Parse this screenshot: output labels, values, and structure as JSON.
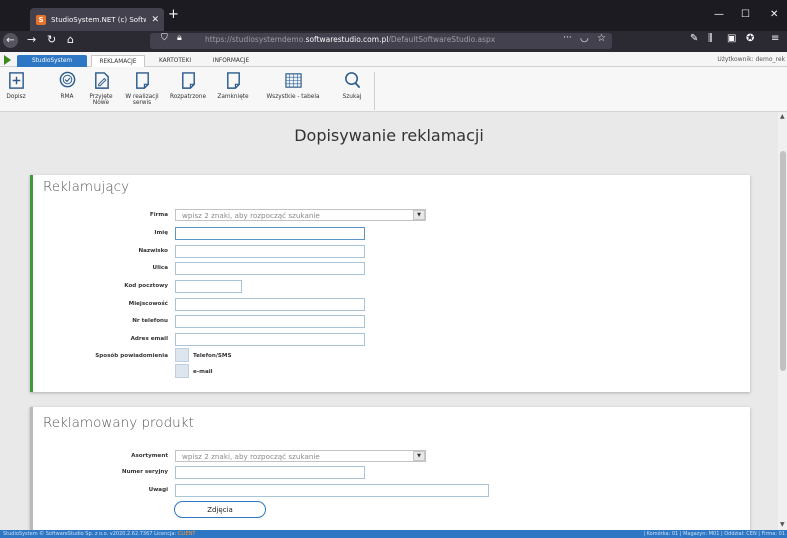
{
  "browser": {
    "tab_title": "StudioSystem.NET (c) Software",
    "tab_favicon": "S",
    "new_tab": "+",
    "url_prefix": "https://studiosystemdemo.",
    "url_domain": "softwarestudio.com.pl",
    "url_path": "/DefaultSoftwareStudio.aspx",
    "url_more": "···"
  },
  "menu": {
    "brand": "StudioSystem",
    "tabs": [
      "REKLAMACJE",
      "KARTOTEKI",
      "INFORMACJE"
    ],
    "user": "Użytkownik: demo_rek"
  },
  "ribbon": [
    {
      "label": "Dopisz",
      "label2": "",
      "icon": "add-document-icon"
    },
    {
      "label": "RMA",
      "label2": "",
      "icon": "shield-check-icon"
    },
    {
      "label": "Przyjęte",
      "label2": "Nowe",
      "icon": "edit-document-icon"
    },
    {
      "label": "W realizacji",
      "label2": "serwis",
      "icon": "document-icon"
    },
    {
      "label": "Rozpatrzone",
      "label2": "",
      "icon": "document-icon"
    },
    {
      "label": "Zamknięte",
      "label2": "",
      "icon": "document-icon"
    },
    {
      "label": "Wszystkie - tabela",
      "label2": "",
      "icon": "table-icon"
    },
    {
      "label": "Szukaj",
      "label2": "",
      "icon": "search-icon"
    }
  ],
  "page": {
    "title": "Dopisywanie reklamacji"
  },
  "section1": {
    "title": "Reklamujący",
    "firma_label": "Firma",
    "firma_placeholder": "wpisz 2 znaki, aby rozpocząć szukanie",
    "labels": [
      "Imię",
      "Nazwisko",
      "Ulica",
      "Kod pocztowy",
      "Miejscowość",
      "Nr telefonu",
      "Adres email"
    ],
    "notify_label": "Sposób powiadomienia",
    "notify_options": [
      "Telefon/SMS",
      "e-mail"
    ]
  },
  "section2": {
    "title": "Reklamowany produkt",
    "asortyment_label": "Asortyment",
    "asortyment_placeholder": "wpisz 2 znaki, aby rozpocząć szukanie",
    "serial_label": "Numer seryjny",
    "notes_label": "Uwagi",
    "photos_button": "Zdjęcia"
  },
  "status": {
    "left_prefix": "StudioSystem © SoftwareStudio Sp. z o.o.  v2020.2.62.7367   Licencja: ",
    "license": "CLIENT",
    "right": "| Komórka: 01 | Magazyn: M01 | Oddział: CEN | Firma: 01"
  },
  "colors": {
    "brand": "#2e77c4",
    "accent_green": "#3c9c3c"
  }
}
